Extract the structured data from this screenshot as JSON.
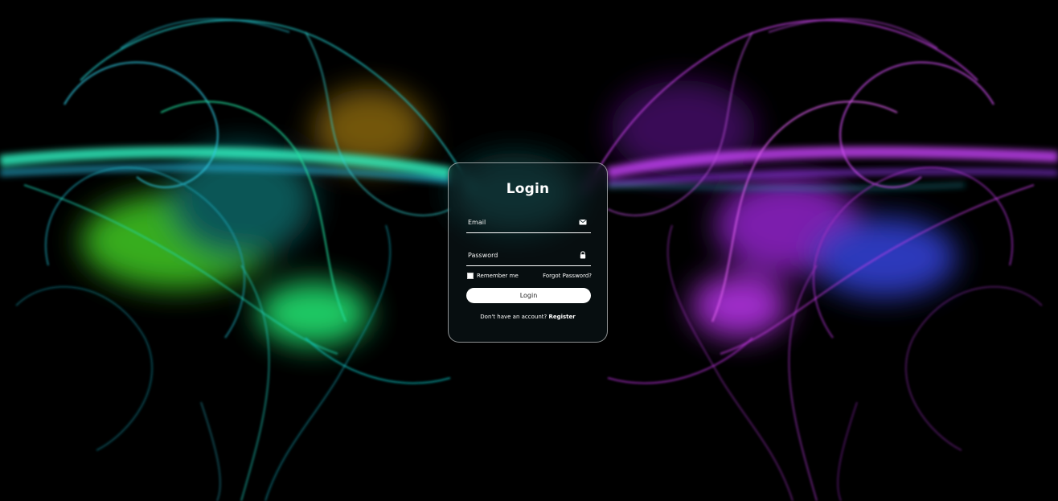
{
  "login": {
    "title": "Login",
    "email_placeholder": "Email",
    "password_placeholder": "Password",
    "remember_label": "Remember me",
    "forgot_link": "Forgot Password?",
    "submit_label": "Login",
    "register_prompt": "Don't have an account?",
    "register_link": "Register"
  },
  "icons": {
    "email": "mail-icon",
    "password": "lock-icon"
  },
  "colors": {
    "background": "#000000",
    "accent_left": "#20e0b0",
    "accent_right": "#c040f0",
    "button_bg": "#ffffff",
    "text": "#ffffff"
  }
}
